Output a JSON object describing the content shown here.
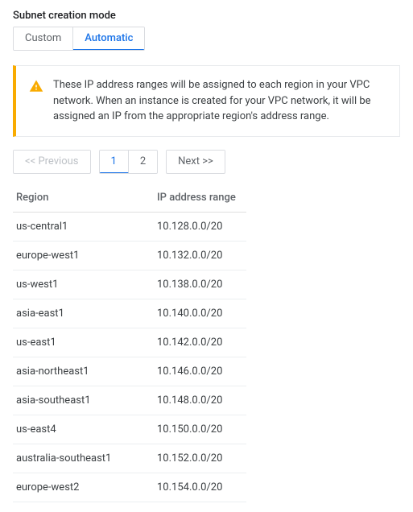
{
  "section_label": "Subnet creation mode",
  "tabs": {
    "custom": "Custom",
    "automatic": "Automatic"
  },
  "info_message": "These IP address ranges will be assigned to each region in your VPC network. When an instance is created for your VPC network, it will be assigned an IP from the appropriate region's address range.",
  "pager": {
    "prev": "<< Previous",
    "next": "Next >>",
    "pages": [
      "1",
      "2"
    ]
  },
  "table": {
    "headers": {
      "region": "Region",
      "range": "IP address range"
    },
    "rows": [
      {
        "region": "us-central1",
        "range": "10.128.0.0/20"
      },
      {
        "region": "europe-west1",
        "range": "10.132.0.0/20"
      },
      {
        "region": "us-west1",
        "range": "10.138.0.0/20"
      },
      {
        "region": "asia-east1",
        "range": "10.140.0.0/20"
      },
      {
        "region": "us-east1",
        "range": "10.142.0.0/20"
      },
      {
        "region": "asia-northeast1",
        "range": "10.146.0.0/20"
      },
      {
        "region": "asia-southeast1",
        "range": "10.148.0.0/20"
      },
      {
        "region": "us-east4",
        "range": "10.150.0.0/20"
      },
      {
        "region": "australia-southeast1",
        "range": "10.152.0.0/20"
      },
      {
        "region": "europe-west2",
        "range": "10.154.0.0/20"
      }
    ]
  }
}
